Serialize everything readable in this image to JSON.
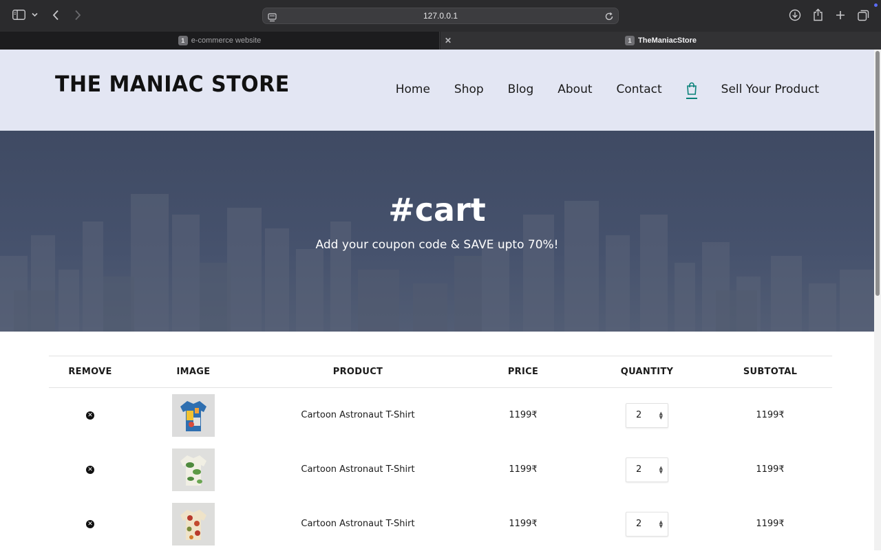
{
  "browser": {
    "url": "127.0.0.1",
    "tabs": [
      {
        "label": "e-commerce website",
        "badge": "1",
        "active": false
      },
      {
        "label": "TheManiacStore",
        "badge": "1",
        "active": true
      }
    ],
    "icons": [
      "sidebar-icon",
      "chevron-down-icon",
      "back-icon",
      "forward-icon",
      "site-settings-icon",
      "reload-icon",
      "download-icon",
      "share-icon",
      "new-tab-icon",
      "tab-overview-icon",
      "close-icon"
    ]
  },
  "header": {
    "logo": "THE MANIAC STORE",
    "nav": [
      {
        "label": "Home"
      },
      {
        "label": "Shop"
      },
      {
        "label": "Blog"
      },
      {
        "label": "About"
      },
      {
        "label": "Contact"
      }
    ],
    "cart_icon": "shopping-bag-icon",
    "sell_label": "Sell Your Product",
    "accent": "#088178"
  },
  "hero": {
    "title": "#cart",
    "subtitle": "Add your coupon code & SAVE upto 70%!"
  },
  "cart": {
    "headers": {
      "remove": "REMOVE",
      "image": "IMAGE",
      "product": "PRODUCT",
      "price": "PRICE",
      "quantity": "QUANTITY",
      "subtotal": "SUBTOTAL"
    },
    "rows": [
      {
        "product": "Cartoon Astronaut T-Shirt",
        "price": "1199₹",
        "quantity": "2",
        "subtotal": "1199₹"
      },
      {
        "product": "Cartoon Astronaut T-Shirt",
        "price": "1199₹",
        "quantity": "2",
        "subtotal": "1199₹"
      },
      {
        "product": "Cartoon Astronaut T-Shirt",
        "price": "1199₹",
        "quantity": "2",
        "subtotal": "1199₹"
      }
    ]
  }
}
